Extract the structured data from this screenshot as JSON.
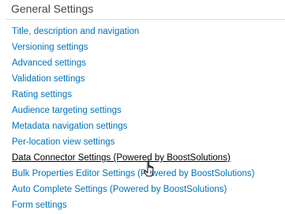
{
  "section": {
    "title": "General Settings"
  },
  "links": [
    {
      "label": "Title, description and navigation"
    },
    {
      "label": "Versioning settings"
    },
    {
      "label": "Advanced settings"
    },
    {
      "label": "Validation settings"
    },
    {
      "label": "Rating settings"
    },
    {
      "label": "Audience targeting settings"
    },
    {
      "label": "Metadata navigation settings"
    },
    {
      "label": "Per-location view settings"
    },
    {
      "label": "Data Connector Settings (Powered by BoostSolutions)"
    },
    {
      "label": "Bulk Properties Editor Settings (Powered by BoostSolutions)"
    },
    {
      "label": "Auto Complete Settings (Powered by BoostSolutions)"
    },
    {
      "label": "Form settings"
    }
  ],
  "state": {
    "hovered_link": "Data Connector Settings (Powered by BoostSolutions)",
    "cursor_icon": "hand-pointer-icon"
  },
  "colors": {
    "link": "#0072bc",
    "hovered_link": "#000000",
    "title": "#444444",
    "divider": "#dcdcdc"
  }
}
